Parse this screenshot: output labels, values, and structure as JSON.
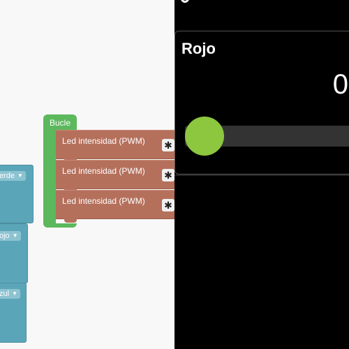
{
  "workspace": {
    "variables": [
      {
        "label": "erde"
      },
      {
        "label": "ojo"
      },
      {
        "label": "zul"
      }
    ],
    "loop": {
      "label": "Bucle"
    },
    "pwm_blocks": [
      {
        "label": "Led intensidad (PWM)"
      },
      {
        "label": "Led intensidad (PWM)"
      },
      {
        "label": "Led intensidad (PWM)"
      }
    ]
  },
  "panel": {
    "card": {
      "title": "Rojo",
      "value": "0",
      "slider_level": 0
    },
    "colors": {
      "thumb": "#8dc63f",
      "loop": "#5cb85c",
      "pwm": "#b5705c",
      "variable": "#5ba5b8"
    }
  }
}
